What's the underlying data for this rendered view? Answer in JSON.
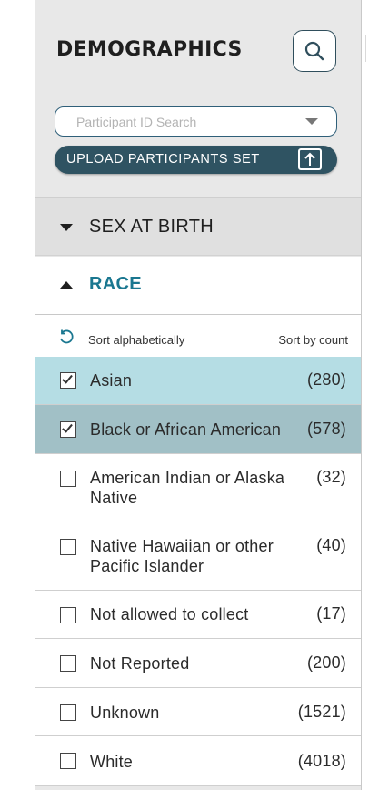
{
  "header": {
    "title": "DEMOGRAPHICS",
    "search_icon": "search-icon"
  },
  "participant_search": {
    "placeholder": "Participant ID Search"
  },
  "upload": {
    "label": "UPLOAD PARTICIPANTS SET",
    "icon": "upload-icon"
  },
  "sections": {
    "sex_at_birth": {
      "label": "SEX AT BIRTH",
      "expanded": false
    },
    "race": {
      "label": "RACE",
      "expanded": true
    }
  },
  "colors": {
    "accent": "#1a7790",
    "button_dark": "#2f5362",
    "selected_row_1": "#b5dde4",
    "selected_row_2": "#a1c0c6"
  },
  "sort": {
    "alphabetically": "Sort alphabetically",
    "by_count": "Sort by count"
  },
  "race_options": [
    {
      "label": "Asian",
      "count": "(280)",
      "checked": true
    },
    {
      "label": "Black or African American",
      "count": "(578)",
      "checked": true
    },
    {
      "label": "American Indian or Alaska Native",
      "count": "(32)",
      "checked": false
    },
    {
      "label": "Native Hawaiian or other Pacific Islander",
      "count": "(40)",
      "checked": false
    },
    {
      "label": "Not allowed to collect",
      "count": "(17)",
      "checked": false
    },
    {
      "label": "Not Reported",
      "count": "(200)",
      "checked": false
    },
    {
      "label": "Unknown",
      "count": "(1521)",
      "checked": false
    },
    {
      "label": "White",
      "count": "(4018)",
      "checked": false
    }
  ]
}
